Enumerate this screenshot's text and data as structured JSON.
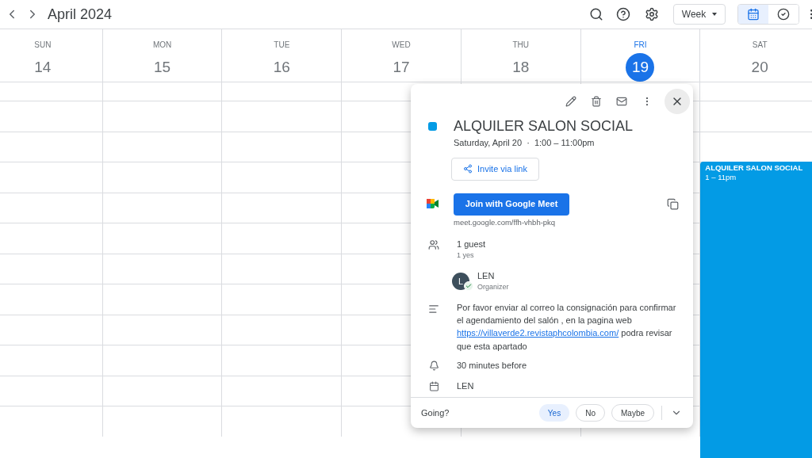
{
  "toolbar": {
    "title": "April 2024",
    "view": "Week",
    "view_toggle": [
      {
        "kind": "calendar",
        "selected": true
      },
      {
        "kind": "tasks",
        "selected": false
      }
    ]
  },
  "days": [
    {
      "dow": "SUN",
      "date": "14",
      "today": false
    },
    {
      "dow": "MON",
      "date": "15",
      "today": false
    },
    {
      "dow": "TUE",
      "date": "16",
      "today": false
    },
    {
      "dow": "WED",
      "date": "17",
      "today": false
    },
    {
      "dow": "THU",
      "date": "18",
      "today": false
    },
    {
      "dow": "FRI",
      "date": "19",
      "today": true
    },
    {
      "dow": "SAT",
      "date": "20",
      "today": false,
      "events": [
        {
          "title": "ALQUILER SALON SOCIAL",
          "time": "1 – 11pm"
        }
      ]
    }
  ],
  "popup": {
    "title": "ALQUILER SALON SOCIAL",
    "date_time": "Saturday, April 20  ·  1:00 – 11:00pm",
    "invite_button": "Invite via link",
    "meet_button": "Join with Google Meet",
    "meet_link": "meet.google.com/ffh-vhbh-pkq",
    "guests_count": "1 guest",
    "guests_status": "1 yes",
    "guests": [
      {
        "initial": "L",
        "name": "LEN",
        "role": "Organizer",
        "accepted": true
      }
    ],
    "description": {
      "before": "Por favor enviar al correo la consignación para confirmar el agendamiento del salón , en la pagina web ",
      "link": "https://villaverde2.revistaphcolombia.com/",
      "after": " podra revisar que esta apartado"
    },
    "reminder": "30 minutes before",
    "calendar": "LEN",
    "rsvp": {
      "label": "Going?",
      "options": [
        {
          "label": "Yes",
          "selected": true
        },
        {
          "label": "No",
          "selected": false
        },
        {
          "label": "Maybe",
          "selected": false
        }
      ]
    }
  }
}
